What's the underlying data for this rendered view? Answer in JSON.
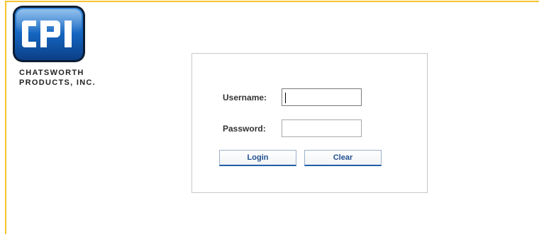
{
  "company": {
    "logo_text": "CPI",
    "name_line1": "CHATSWORTH",
    "name_line2": "PRODUCTS, INC."
  },
  "login_form": {
    "username_label": "Username:",
    "username_value": "",
    "password_label": "Password:",
    "password_value": "",
    "login_button": "Login",
    "clear_button": "Clear"
  },
  "colors": {
    "frame_border": "#f7c32e",
    "logo_blue": "#1f6fc4",
    "button_text": "#1f4f8f"
  },
  "icons": {
    "logo": "cpi-logo-icon"
  }
}
